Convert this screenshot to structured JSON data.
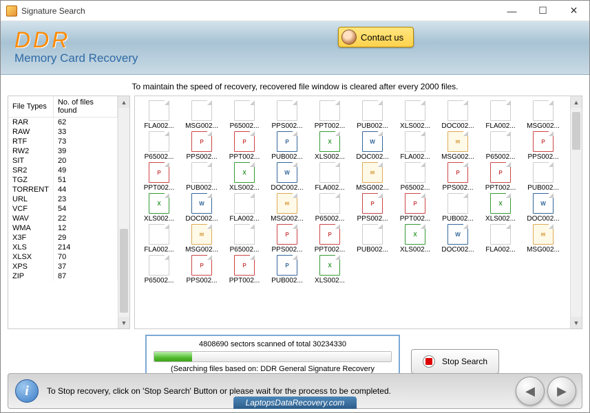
{
  "window": {
    "title": "Signature Search"
  },
  "header": {
    "logo": "DDR",
    "subtitle": "Memory Card Recovery",
    "contact": "Contact us"
  },
  "notice": "To maintain the speed of recovery, recovered file window is cleared after every 2000 files.",
  "table": {
    "headers": [
      "File Types",
      "No. of files found"
    ],
    "rows": [
      [
        "RAR",
        "62"
      ],
      [
        "RAW",
        "33"
      ],
      [
        "RTF",
        "73"
      ],
      [
        "RW2",
        "39"
      ],
      [
        "SIT",
        "20"
      ],
      [
        "SR2",
        "49"
      ],
      [
        "TGZ",
        "51"
      ],
      [
        "TORRENT",
        "44"
      ],
      [
        "URL",
        "23"
      ],
      [
        "VCF",
        "54"
      ],
      [
        "WAV",
        "22"
      ],
      [
        "WMA",
        "12"
      ],
      [
        "X3F",
        "29"
      ],
      [
        "XLS",
        "214"
      ],
      [
        "XLSX",
        "70"
      ],
      [
        "XPS",
        "37"
      ],
      [
        "ZIP",
        "87"
      ]
    ]
  },
  "files": [
    [
      [
        "FLA002...",
        "blank"
      ],
      [
        "MSG002...",
        "blank"
      ],
      [
        "P65002...",
        "blank"
      ],
      [
        "PPS002...",
        "blank"
      ],
      [
        "PPT002...",
        "blank"
      ],
      [
        "PUB002...",
        "blank"
      ],
      [
        "XLS002...",
        "blank"
      ],
      [
        "DOC002...",
        "blank"
      ],
      [
        "FLA002...",
        "blank"
      ],
      [
        "MSG002...",
        "blank"
      ]
    ],
    [
      [
        "P65002...",
        "blank"
      ],
      [
        "PPS002...",
        "pps"
      ],
      [
        "PPT002...",
        "ppt"
      ],
      [
        "PUB002...",
        "pub"
      ],
      [
        "XLS002...",
        "xls"
      ],
      [
        "DOC002...",
        "doc"
      ],
      [
        "FLA002...",
        "blank"
      ],
      [
        "MSG002...",
        "msg"
      ],
      [
        "P65002...",
        "blank"
      ],
      [
        "PPS002...",
        "pps"
      ]
    ],
    [
      [
        "PPT002...",
        "ppt"
      ],
      [
        "PUB002...",
        "blank"
      ],
      [
        "XLS002...",
        "xls"
      ],
      [
        "DOC002...",
        "doc"
      ],
      [
        "FLA002...",
        "blank"
      ],
      [
        "MSG002...",
        "msg"
      ],
      [
        "P65002...",
        "blank"
      ],
      [
        "PPS002...",
        "pps"
      ],
      [
        "PPT002...",
        "ppt"
      ],
      [
        "PUB002...",
        "blank"
      ]
    ],
    [
      [
        "XLS002...",
        "xls"
      ],
      [
        "DOC002...",
        "doc"
      ],
      [
        "FLA002...",
        "blank"
      ],
      [
        "MSG002...",
        "msg"
      ],
      [
        "P65002...",
        "blank"
      ],
      [
        "PPS002...",
        "pps"
      ],
      [
        "PPT002...",
        "ppt"
      ],
      [
        "PUB002...",
        "blank"
      ],
      [
        "XLS002...",
        "xls"
      ],
      [
        "DOC002...",
        "doc"
      ]
    ],
    [
      [
        "FLA002...",
        "blank"
      ],
      [
        "MSG002...",
        "msg"
      ],
      [
        "P65002...",
        "blank"
      ],
      [
        "PPS002...",
        "pps"
      ],
      [
        "PPT002...",
        "ppt"
      ],
      [
        "PUB002...",
        "blank"
      ],
      [
        "XLS002...",
        "xls"
      ],
      [
        "DOC002...",
        "doc"
      ],
      [
        "FLA002...",
        "blank"
      ],
      [
        "MSG002...",
        "msg"
      ]
    ],
    [
      [
        "P65002...",
        "blank"
      ],
      [
        "PPS002...",
        "pps"
      ],
      [
        "PPT002...",
        "ppt"
      ],
      [
        "PUB002...",
        "pub"
      ],
      [
        "XLS002...",
        "xls"
      ]
    ]
  ],
  "progress": {
    "text": "4808690 sectors scanned of total 30234330",
    "sub": "(Searching files based on:  DDR General Signature Recovery Procedure)",
    "percent": 16
  },
  "stop": "Stop Search",
  "footer": {
    "text": "To Stop recovery, click on 'Stop Search' Button or please wait for the process to be completed.",
    "link": "LaptopsDataRecovery.com"
  }
}
